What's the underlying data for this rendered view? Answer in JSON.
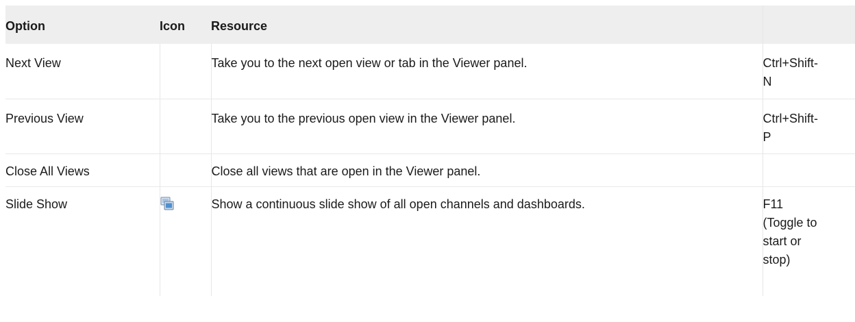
{
  "table": {
    "headers": {
      "option": "Option",
      "icon": "Icon",
      "resource": "Resource",
      "shortcut": ""
    },
    "rows": [
      {
        "option": "Next View",
        "icon": "",
        "resource": "Take you to the next open view or tab in the Viewer panel.",
        "shortcut_line1": "Ctrl+Shift-",
        "shortcut_line2": "N"
      },
      {
        "option": "Previous View",
        "icon": "",
        "resource": "Take you to the previous open view in the Viewer panel.",
        "shortcut_line1": "Ctrl+Shift-",
        "shortcut_line2": "P"
      },
      {
        "option": "Close All Views",
        "icon": "",
        "resource": "Close all views that are open in the Viewer panel.",
        "shortcut_line1": "",
        "shortcut_line2": ""
      },
      {
        "option": "Slide Show",
        "icon": "slide-show-icon",
        "resource": "Show a continuous slide show of all open channels and dashboards.",
        "shortcut_line1": "F11",
        "shortcut_line2": "(Toggle to",
        "shortcut_line3": "start or",
        "shortcut_line4": "stop)"
      }
    ]
  },
  "colors": {
    "header_bg": "#eeeeee",
    "border": "#e6e6e6",
    "text": "#1a1a1a"
  }
}
